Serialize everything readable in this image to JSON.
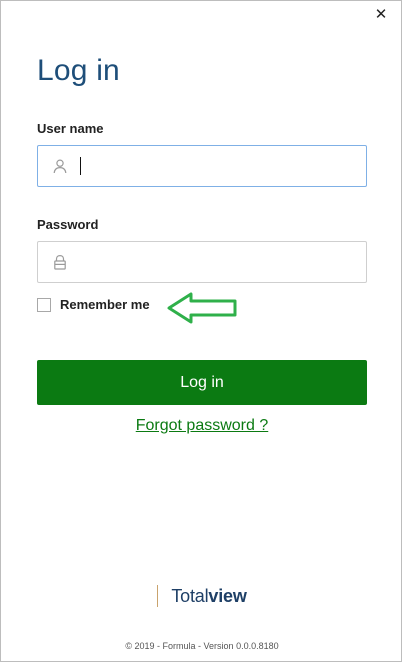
{
  "window": {
    "close_symbol": "✕"
  },
  "form": {
    "title": "Log in",
    "username_label": "User name",
    "username_value": "",
    "password_label": "Password",
    "password_value": "",
    "remember_label": "Remember me",
    "remember_checked": false,
    "login_button": "Log in",
    "forgot_link": "Forgot password ?"
  },
  "branding": {
    "brand_name_part1": "Total",
    "brand_name_part2": "view",
    "footer": "© 2019 - Formula - Version 0.0.0.8180"
  },
  "colors": {
    "accent_green": "#0b7a12",
    "title_blue": "#1e4e79",
    "focus_border": "#7fb0e6"
  },
  "icons": {
    "username": "user-icon",
    "password": "lock-icon",
    "close": "close-icon",
    "annotation": "left-arrow-annotation-icon"
  }
}
